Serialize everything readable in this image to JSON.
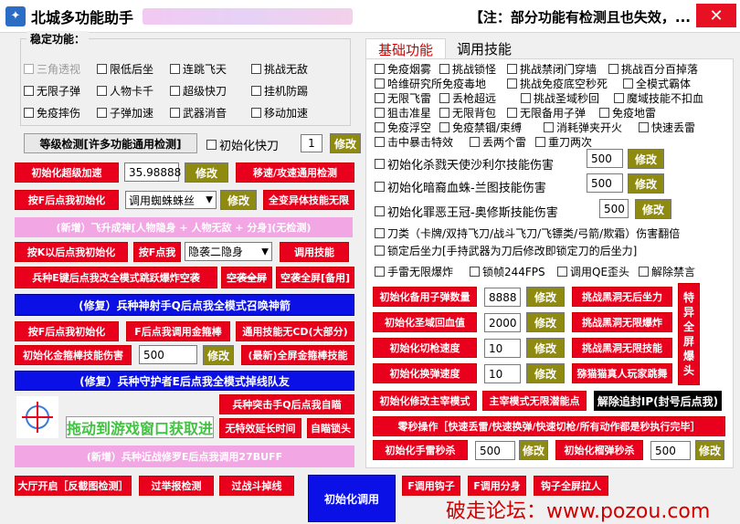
{
  "window": {
    "icon": "app-icon",
    "title": "北城多功能助手",
    "notice": "【注：部分功能有检测且也失效，...",
    "close": "✕"
  },
  "stable_group": {
    "title": "稳定功能：",
    "checkboxes": [
      "三角透视",
      "限低后坐",
      "连跳飞天",
      "挑战无敌",
      "无限子弹",
      "人物卡千",
      "超级快刀",
      "挂机防踢",
      "免疫摔伤",
      "子弹加速",
      "武器消音",
      "移动加速"
    ]
  },
  "left": {
    "level_check": "等级检测[许多功能通用检测]",
    "init_fast_knife": "初始化快刀",
    "fast_knife_value": "1",
    "modify": "修改",
    "init_super_speed": "初始化超级加速",
    "speed_value": "35.98888",
    "move_attack_detect": "移速/攻速通用检测",
    "press_f_init": "按F后点我初始化",
    "spider_select": "调用蜘蛛蛛丝",
    "fullbody_nolimit": "全变异体技能无限",
    "flying_new": "(新增）飞升成神[人物隐身 + 人物无敌 + 分身](无检测)",
    "press_k_init": "按K以后点我初始化",
    "press_f_me": "按F点我",
    "stealth_select": "隐袭二隐身",
    "call_skill": "调用技能",
    "e_key_change": "兵种E键后点我改全模式跳跃爆炸空袭",
    "airstrike_full": "空袭全屏",
    "airstrike_backup": "空袭全屏[备用]",
    "fix_sniper": "(修复）兵种神射手Q后点我全模式召唤神箭",
    "press_f_init2": "按F后点我初始化",
    "f_call_golden": "F后点我调用金箍棒",
    "skill_nocd": "通用技能无CD(大部分)",
    "init_golden_damage": "初始化金箍棒技能伤害",
    "golden_value": "500",
    "latest_golden_full": "(最新)全屏金箍棒技能",
    "fix_guardian": "(修复）兵种守护者E后点我全模式掉线队友",
    "assault_q": "兵种突击手Q后点我自瞄",
    "no_special_delay": "无特效延长时间",
    "self_aim_head": "自瞄锁头",
    "drag_hint": "拖动到游戏窗口获取进",
    "new_shura": "(新增）兵种近战修罗E后点我调用27BUFF",
    "lobby_open": "大厅开启［反截图检测］",
    "pass_report": "过举报检测",
    "pass_fight": "过战斗掉线",
    "init_call": "初始化调用"
  },
  "tabs": [
    "基础功能",
    "调用技能"
  ],
  "right": {
    "checkboxes": [
      "免疫烟雾",
      "挑战锁怪",
      "挑战禁闭门穿墙",
      "挑战百分百掉落",
      "哈维研究所免疫毒地",
      "挑战免疫底空秒死",
      "全模式霸体",
      "无限飞雷",
      "丢枪超远",
      "挑战圣域秒回",
      "魔域技能不扣血",
      "狙击准星",
      "无限背包",
      "无限备用子弹",
      "免疫地雷",
      "免疫浮空",
      "免疫禁锢/束缚",
      "消耗弹夹开火",
      "快速丢雷",
      "击中暴击特效",
      "丢两个雷",
      "重刀两次"
    ],
    "init_kill_sky": "初始化杀戮天使沙利尔技能伤害",
    "kill_sky_value": "500",
    "init_dark_blood": "初始化暗裔血蛛-兰图技能伤害",
    "dark_blood_value": "500",
    "init_evil_crown": "初始化罪恶王冠-奥修斯技能伤害",
    "evil_crown_value": "500",
    "knife_types": "刀类（卡牌/双持飞刀/战斗飞刀/飞镖类/弓箭/欺霜）伤害翻倍",
    "lock_recoil": "锁定后坐力[手持武器为刀后修改即锁定刀的后坐力]",
    "grenade_nolimit": "手雷无限爆炸",
    "lock_fps": "锁帧244FPS",
    "call_qe": "调用QE歪头",
    "unlock_ban": "解除禁言",
    "init_ammo": "初始化备用子弹数量",
    "ammo_value": "8888",
    "init_holy_regen": "初始化圣域回血值",
    "holy_value": "2000",
    "init_switch_gun": "初始化切枪速度",
    "switch_value": "10",
    "init_swap_ammo": "初始化换弹速度",
    "swap_value": "10",
    "challenge_blackhole_recoil": "挑战黑洞无后坐力",
    "challenge_blackhole_bomb": "挑战黑洞无限爆炸",
    "challenge_blackhole_skill": "挑战黑洞无限技能",
    "mimi_jump": "猕猫猫真人玩家跳舞",
    "special_full_bomb": [
      "特",
      "异",
      "全",
      "屏",
      "爆",
      "头"
    ],
    "init_mod_mode": "初始化修改主宰模式",
    "mod_mode_nolimit": "主宰模式无限潜能点",
    "untrace_ip": "解除追封IP(封号后点我)",
    "zero_sec_ops": "零秒操作［快速丢雷/快速换弹/快速切枪/所有动作都是秒执行完毕］",
    "init_grenade_sec": "初始化手雷秒杀",
    "grenade_sec_value": "500",
    "init_shotgun_sec": "初始化榴弹秒杀",
    "shotgun_sec_value": "500",
    "f_call_hook": "F调用钩子",
    "f_call_split": "F调用分身",
    "hook_full_pull": "钩子全屏拉人"
  },
  "watermark": "破走论坛：www.pozou.com"
}
